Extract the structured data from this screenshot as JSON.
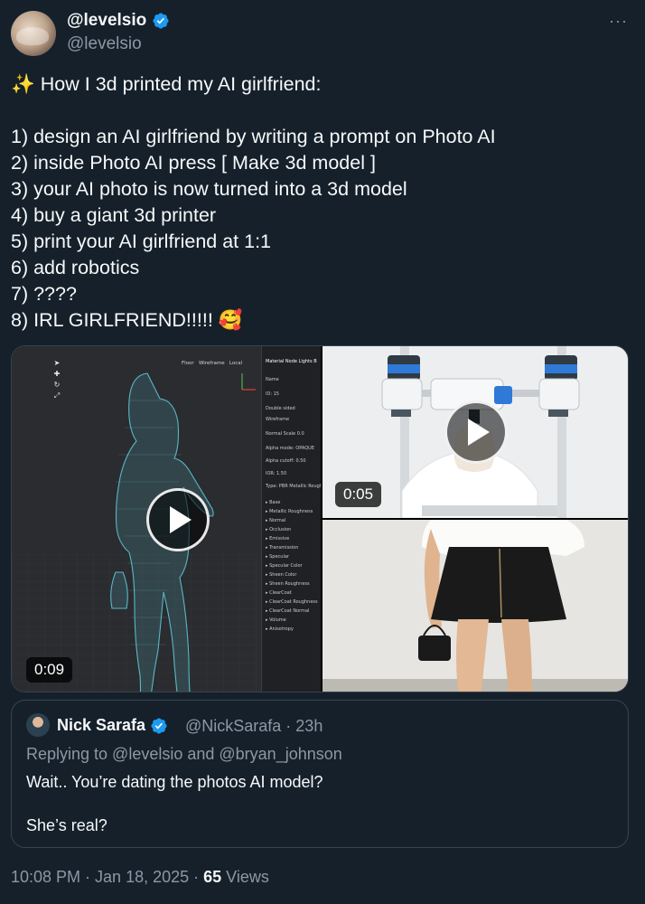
{
  "author": {
    "display_name": "@levelsio",
    "handle": "@levelsio"
  },
  "more_label": "···",
  "tweet": {
    "title_emoji": "✨",
    "title": "How I 3d printed my AI girlfriend:",
    "steps": [
      "1) design an AI girlfriend by writing a prompt on Photo AI",
      "2) inside Photo AI press [ Make 3d model ]",
      "3) your AI photo is now turned into a 3d model",
      "4) buy a giant 3d printer",
      "5) print your AI girlfriend at 1:1",
      "6) add robotics",
      "7) ????",
      "8) IRL GIRLFRIEND!!!!! 🥰"
    ]
  },
  "media": {
    "video_left_duration": "0:09",
    "video_right_duration": "0:05",
    "editor": {
      "toolbar": [
        "Floor",
        "Wireframe",
        "Local"
      ],
      "panel_tabs": "Material  Node  Lights  B",
      "panel_lines": [
        "Name",
        "ID: 15",
        "Double sided",
        "Wireframe",
        "Normal    Scale  0.0",
        "Alpha mode:  OPAQUE",
        "Alpha cutoff:  0.50",
        "IOR:  1.50",
        "Type:  PBR Metallic Rough",
        "▸ Base",
        "▸ Metallic Roughness",
        "▸ Normal",
        "▸ Occlusion",
        "▸ Emissive",
        "▸ Transmission",
        "▸ Specular",
        "▸ Specular Color",
        "▸ Sheen Color",
        "▸ Sheen Roughness",
        "▸ ClearCoat",
        "▸ ClearCoat Roughness",
        "▸ ClearCoat Normal",
        "▸ Volume",
        "▸ Anisotropy"
      ]
    }
  },
  "quote": {
    "name": "Nick Sarafa",
    "meta": "@NickSarafa · 23h",
    "reply": "Replying to @levelsio and @bryan_johnson",
    "line1": "Wait.. You’re dating the photos AI model?",
    "line2": "She’s real?"
  },
  "footer": {
    "time": "10:08 PM · Jan 18, 2025 · ",
    "views_count": "65",
    "views_label": " Views"
  },
  "colors": {
    "background": "#15202b",
    "text": "#f7f9f9",
    "muted": "#8b98a5",
    "verified": "#1d9bf0",
    "border": "#38444d"
  }
}
